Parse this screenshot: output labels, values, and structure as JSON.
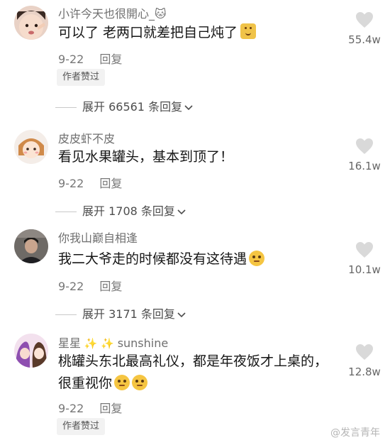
{
  "comments": [
    {
      "username": "小许今天也很開心_",
      "username_emoji": "🐱",
      "text": "可以了 老两口就差把自己炖了",
      "date": "9-22",
      "reply_label": "回复",
      "author_liked": "作者赞过",
      "expand_label": "展开 66561 条回复",
      "likes": "55.4w"
    },
    {
      "username": "皮皮虾不皮",
      "text": "看见水果罐头，基本到顶了！",
      "date": "9-22",
      "reply_label": "回复",
      "expand_label": "展开 1708 条回复",
      "likes": "16.1w"
    },
    {
      "username": "你我山巅自相逢",
      "text": "我二大爷走的时候都没有这待遇",
      "date": "9-22",
      "reply_label": "回复",
      "expand_label": "展开 3171 条回复",
      "likes": "10.1w"
    },
    {
      "username_a": "星星",
      "username_b": "sunshine",
      "text_line1": "桃罐头东北最高礼仪，都是年夜饭才上桌的，",
      "text_line2": "很重视你",
      "date": "9-22",
      "reply_label": "回复",
      "author_liked": "作者赞过",
      "likes": "12.8w"
    }
  ],
  "watermark": "@发言青年",
  "colors": {
    "heart": "#d9d9d9",
    "badge_bg": "#f2f2f2",
    "muted": "#777777"
  },
  "icons": [
    "heart-icon",
    "chevron-down-icon",
    "sparkle-icon",
    "emoji-icon"
  ]
}
